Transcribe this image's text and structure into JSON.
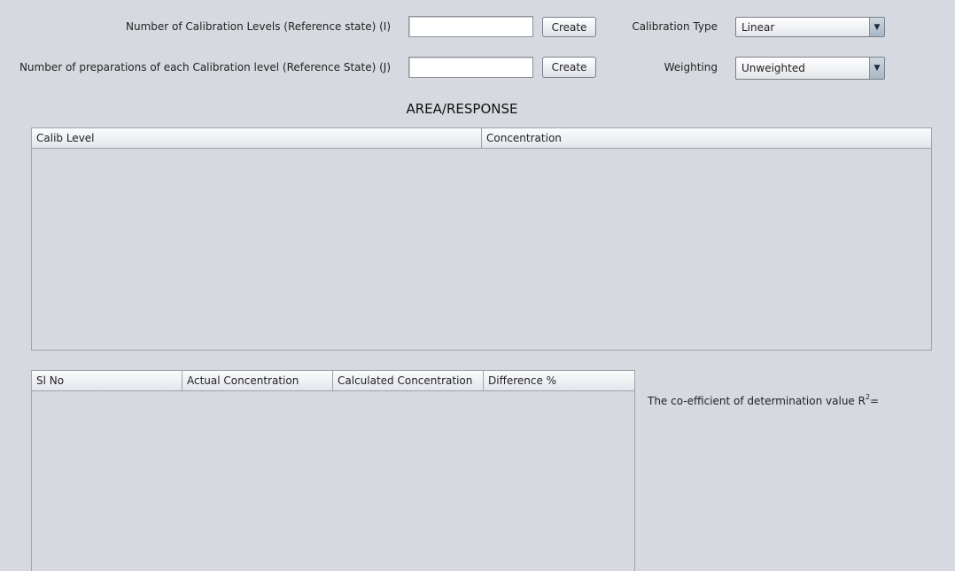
{
  "form": {
    "levels_label": "Number of Calibration Levels (Reference state) (I)",
    "levels_value": "",
    "levels_create": "Create",
    "preps_label": "Number of preparations of each Calibration level (Reference State) (J)",
    "preps_value": "",
    "preps_create": "Create",
    "calib_type_label": "Calibration Type",
    "calib_type_value": "Linear",
    "weighting_label": "Weighting",
    "weighting_value": "Unweighted"
  },
  "section_title": "AREA/RESPONSE",
  "calib_table": {
    "columns": [
      "Calib Level",
      "Concentration"
    ],
    "rows": []
  },
  "result_table": {
    "columns": [
      "Sl No",
      "Actual Concentration",
      "Calculated Concentration",
      "Difference %"
    ],
    "rows": []
  },
  "r2": {
    "label": "The co-efficient of determination value R",
    "superscript": "2",
    "suffix": "=",
    "value": ""
  },
  "icons": {
    "dropdown_arrow": "chevron-down-icon"
  }
}
